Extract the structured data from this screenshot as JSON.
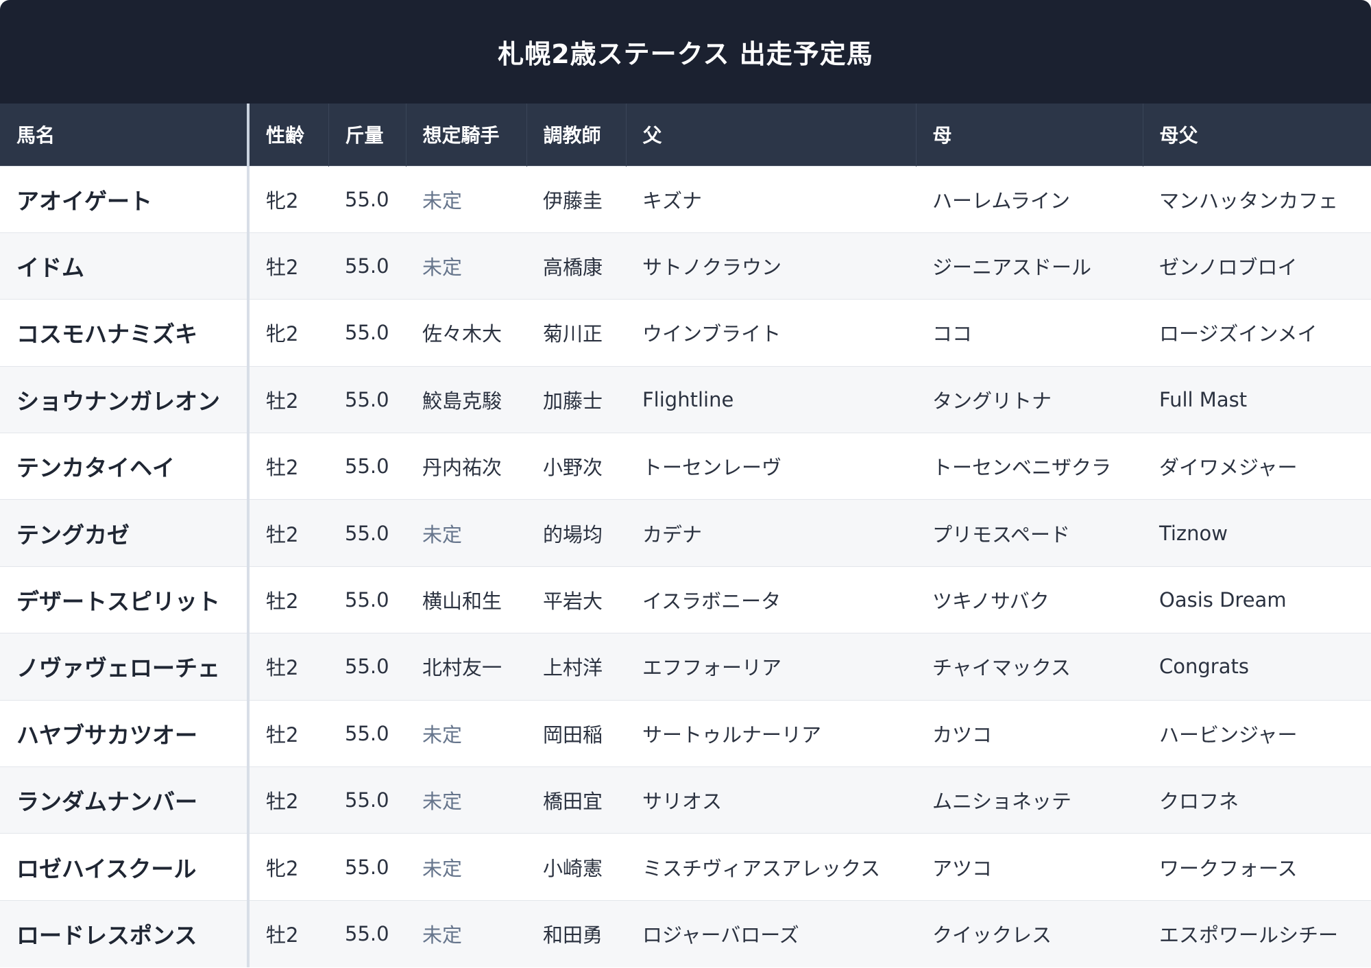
{
  "title": "札幌2歳ステークス 出走予定馬",
  "columns": [
    "馬名",
    "性齢",
    "斤量",
    "想定騎手",
    "調教師",
    "父",
    "母",
    "母父"
  ],
  "rows": [
    {
      "name": "アオイゲート",
      "sex_age": "牝2",
      "weight": "55.0",
      "jockey": "未定",
      "trainer": "伊藤圭",
      "sire": "キズナ",
      "dam": "ハーレムライン",
      "broodmare_sire": "マンハッタンカフェ"
    },
    {
      "name": "イドム",
      "sex_age": "牡2",
      "weight": "55.0",
      "jockey": "未定",
      "trainer": "高橋康",
      "sire": "サトノクラウン",
      "dam": "ジーニアスドール",
      "broodmare_sire": "ゼンノロブロイ"
    },
    {
      "name": "コスモハナミズキ",
      "sex_age": "牝2",
      "weight": "55.0",
      "jockey": "佐々木大",
      "trainer": "菊川正",
      "sire": "ウインブライト",
      "dam": "ココ",
      "broodmare_sire": "ロージズインメイ"
    },
    {
      "name": "ショウナンガレオン",
      "sex_age": "牡2",
      "weight": "55.0",
      "jockey": "鮫島克駿",
      "trainer": "加藤士",
      "sire": "Flightline",
      "dam": "タングリトナ",
      "broodmare_sire": "Full Mast"
    },
    {
      "name": "テンカタイヘイ",
      "sex_age": "牡2",
      "weight": "55.0",
      "jockey": "丹内祐次",
      "trainer": "小野次",
      "sire": "トーセンレーヴ",
      "dam": "トーセンベニザクラ",
      "broodmare_sire": "ダイワメジャー"
    },
    {
      "name": "テングカゼ",
      "sex_age": "牡2",
      "weight": "55.0",
      "jockey": "未定",
      "trainer": "的場均",
      "sire": "カデナ",
      "dam": "プリモスペード",
      "broodmare_sire": "Tiznow"
    },
    {
      "name": "デザートスピリット",
      "sex_age": "牡2",
      "weight": "55.0",
      "jockey": "横山和生",
      "trainer": "平岩大",
      "sire": "イスラボニータ",
      "dam": "ツキノサバク",
      "broodmare_sire": "Oasis Dream"
    },
    {
      "name": "ノヴァヴェローチェ",
      "sex_age": "牡2",
      "weight": "55.0",
      "jockey": "北村友一",
      "trainer": "上村洋",
      "sire": "エフフォーリア",
      "dam": "チャイマックス",
      "broodmare_sire": "Congrats"
    },
    {
      "name": "ハヤブサカツオー",
      "sex_age": "牡2",
      "weight": "55.0",
      "jockey": "未定",
      "trainer": "岡田稲",
      "sire": "サートゥルナーリア",
      "dam": "カツコ",
      "broodmare_sire": "ハービンジャー"
    },
    {
      "name": "ランダムナンバー",
      "sex_age": "牡2",
      "weight": "55.0",
      "jockey": "未定",
      "trainer": "橋田宜",
      "sire": "サリオス",
      "dam": "ムニショネッテ",
      "broodmare_sire": "クロフネ"
    },
    {
      "name": "ロゼハイスクール",
      "sex_age": "牝2",
      "weight": "55.0",
      "jockey": "未定",
      "trainer": "小崎憲",
      "sire": "ミスチヴィアスアレックス",
      "dam": "アツコ",
      "broodmare_sire": "ワークフォース"
    },
    {
      "name": "ロードレスポンス",
      "sex_age": "牡2",
      "weight": "55.0",
      "jockey": "未定",
      "trainer": "和田勇",
      "sire": "ロジャーバローズ",
      "dam": "クイックレス",
      "broodmare_sire": "エスポワールシチー"
    }
  ],
  "colors": {
    "title_bg": "#1b2130",
    "header_bg": "#2c3648",
    "row_alt_bg": "#f6f7f9",
    "undecided_text": "#66758c"
  }
}
